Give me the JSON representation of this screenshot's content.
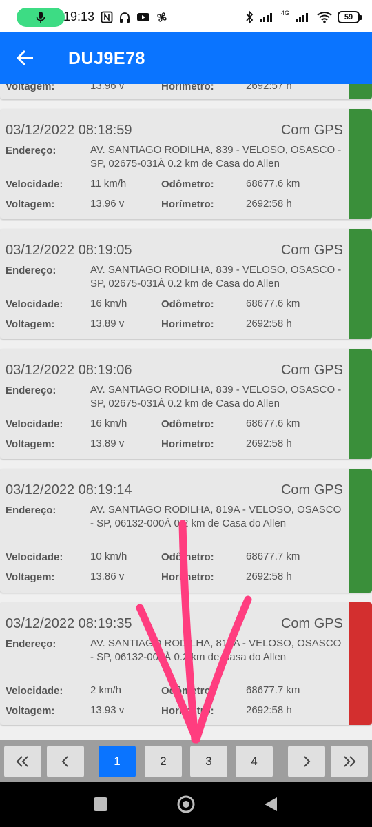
{
  "status_bar": {
    "time": "19:13",
    "network_label": "4G",
    "battery": "59"
  },
  "app_bar": {
    "title": "DUJ9E78",
    "back_icon": "arrow-left-icon"
  },
  "labels": {
    "address": "Endereço:",
    "speed": "Velocidade:",
    "odometer": "Odômetro:",
    "voltage": "Voltagem:",
    "hour_meter": "Horímetro:"
  },
  "partial_card": {
    "voltage_label": "Voltagem:",
    "voltage": "13.96 v",
    "hour_meter_label": "Horímetro:",
    "hour_meter": "2692:57 h"
  },
  "records": [
    {
      "datetime": "03/12/2022 08:18:59",
      "gps": "Com GPS",
      "address": "AV. SANTIAGO RODILHA, 839 - VELOSO, OSASCO - SP, 02675-031À 0.2 km de Casa do Allen",
      "speed": "11 km/h",
      "odometer": "68677.6 km",
      "voltage": "13.96 v",
      "hour_meter": "2692:58 h",
      "status_color": "#3a8f3a"
    },
    {
      "datetime": "03/12/2022 08:19:05",
      "gps": "Com GPS",
      "address": "AV. SANTIAGO RODILHA, 839 - VELOSO, OSASCO - SP, 02675-031À 0.2 km de Casa do Allen",
      "speed": "16 km/h",
      "odometer": "68677.6 km",
      "voltage": "13.89 v",
      "hour_meter": "2692:58 h",
      "status_color": "#3a8f3a"
    },
    {
      "datetime": "03/12/2022 08:19:06",
      "gps": "Com GPS",
      "address": "AV. SANTIAGO RODILHA, 839 - VELOSO, OSASCO - SP, 02675-031À 0.2 km de Casa do Allen",
      "speed": "16 km/h",
      "odometer": "68677.6 km",
      "voltage": "13.89 v",
      "hour_meter": "2692:58 h",
      "status_color": "#3a8f3a"
    },
    {
      "datetime": "03/12/2022 08:19:14",
      "gps": "Com GPS",
      "address": "AV. SANTIAGO RODILHA, 819A - VELOSO, OSASCO - SP, 06132-000À 0.2 km de Casa do Allen",
      "speed": "10 km/h",
      "odometer": "68677.7 km",
      "voltage": "13.86 v",
      "hour_meter": "2692:58 h",
      "status_color": "#3a8f3a"
    },
    {
      "datetime": "03/12/2022 08:19:35",
      "gps": "Com GPS",
      "address": "AV. SANTIAGO RODILHA, 819A - VELOSO, OSASCO - SP, 06132-000À 0.2 km de Casa do Allen",
      "speed": "2 km/h",
      "odometer": "68677.7 km",
      "voltage": "13.93 v",
      "hour_meter": "2692:58 h",
      "status_color": "#d32f2f"
    }
  ],
  "pagination": {
    "first": "«",
    "prev": "‹",
    "pages": [
      "1",
      "2",
      "3",
      "4"
    ],
    "active_page": "1",
    "next": "›",
    "last": "»"
  },
  "colors": {
    "app_bar": "#0a74ff",
    "ok_status": "#3a8f3a",
    "alert_status": "#d32f2f",
    "annotation_arrow": "#ff3d7f"
  }
}
